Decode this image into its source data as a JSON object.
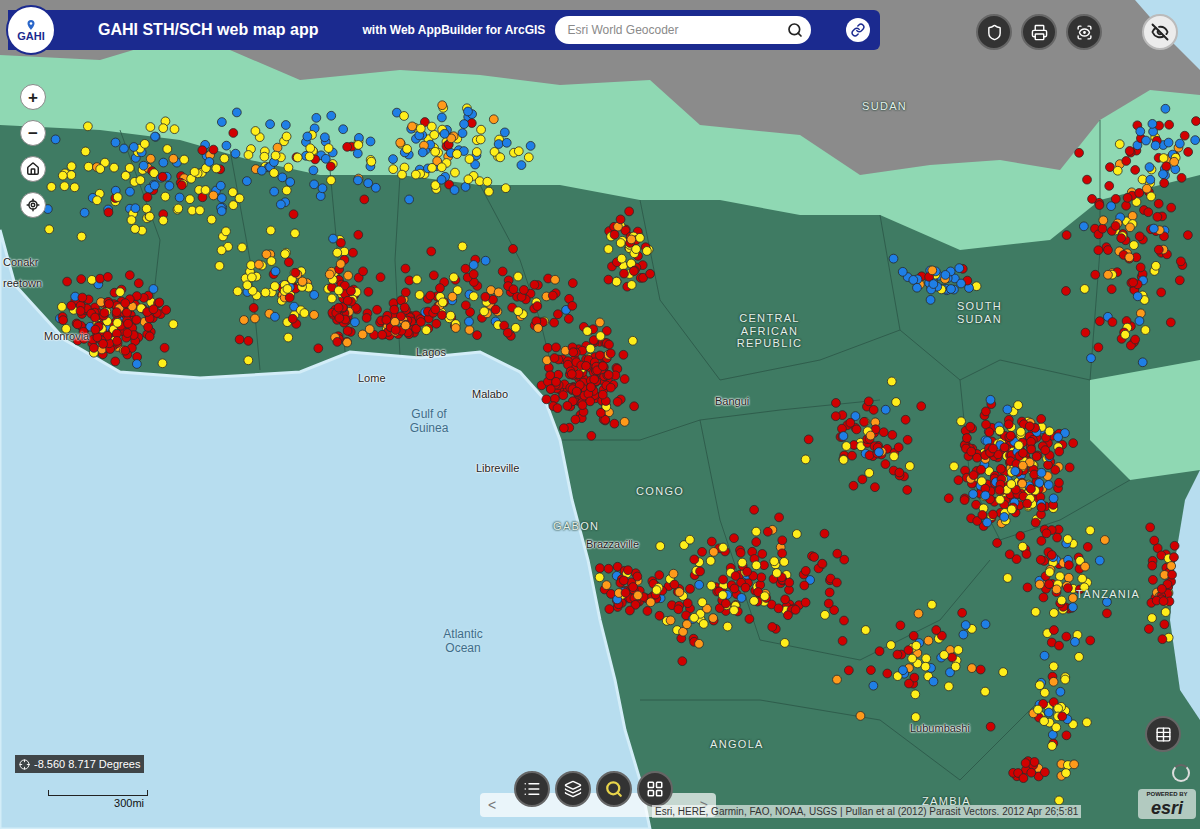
{
  "header": {
    "logo": "GAHI",
    "title": "GAHI STH/SCH web map app",
    "subtitle": "with Web AppBuilder for ArcGIS",
    "search": {
      "placeholder": "Esri World Geocoder"
    }
  },
  "zoom_controls": [
    "+",
    "−"
  ],
  "map": {
    "labels": [
      {
        "text": "SUDAN",
        "kind": "country"
      },
      {
        "text": "CENTRAL AFRICAN REPUBLIC",
        "kind": "country"
      },
      {
        "text": "SOUTH SUDAN",
        "kind": "country"
      },
      {
        "text": "GABON",
        "kind": "country"
      },
      {
        "text": "CONGO",
        "kind": "country"
      },
      {
        "text": "TANZANIA",
        "kind": "country"
      },
      {
        "text": "ANGOLA",
        "kind": "country"
      },
      {
        "text": "ZAMBIA",
        "kind": "country"
      },
      {
        "text": "Gulf of Guinea",
        "kind": "water"
      },
      {
        "text": "Atlantic Ocean",
        "kind": "water"
      },
      {
        "text": "Monrovia",
        "kind": "city"
      },
      {
        "text": "reetown",
        "kind": "city"
      },
      {
        "text": "Conakr",
        "kind": "city"
      },
      {
        "text": "Lome",
        "kind": "city"
      },
      {
        "text": "Lagos",
        "kind": "city"
      },
      {
        "text": "Malabo",
        "kind": "city"
      },
      {
        "text": "Libreville",
        "kind": "city"
      },
      {
        "text": "Bangui",
        "kind": "city"
      },
      {
        "text": "Brazzaville",
        "kind": "city"
      },
      {
        "text": "Lubumbashi",
        "kind": "city"
      }
    ],
    "site_classes": [
      {
        "color": "#d10000"
      },
      {
        "color": "#ff9a1a"
      },
      {
        "color": "#ffee1a"
      },
      {
        "color": "#1f7fe6"
      }
    ]
  },
  "coordinates": "-8.560 8.717 Degrees",
  "scale": "300mi",
  "pager": {
    "prev": "<",
    "next": ">"
  },
  "attribution": "Esri, HERE, Garmin, FAO, NOAA, USGS | Pullan et al (2012) Parasit Vectors. 2012 Apr 26;5:81",
  "powered_by": {
    "line1": "POWERED BY",
    "line2": "esri"
  }
}
